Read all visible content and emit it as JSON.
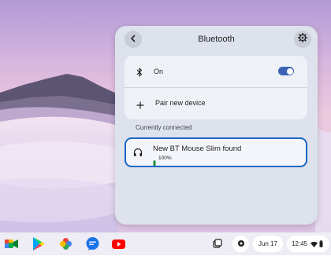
{
  "header": {
    "title": "Bluetooth",
    "back_icon": "arrow-back-icon",
    "settings_icon": "gear-icon"
  },
  "bluetooth": {
    "status_label": "On",
    "enabled": true,
    "icon": "bluetooth-icon"
  },
  "pair": {
    "label": "Pair new device",
    "icon": "plus-icon"
  },
  "connected": {
    "section_label": "Currently connected",
    "devices": [
      {
        "name": "New BT Mouse Slim found",
        "battery": "100%",
        "icon": "headphones-icon"
      }
    ]
  },
  "shelf": {
    "apps": [
      "launcher-icon",
      "google-meet-icon",
      "google-play-icon",
      "google-photos-icon",
      "messages-icon",
      "youtube-icon"
    ],
    "date": "Jun 17",
    "time": "12:45"
  },
  "colors": {
    "accent": "#1d66c8",
    "toggle": "#3a63b8",
    "battery": "#1e8e3e"
  }
}
